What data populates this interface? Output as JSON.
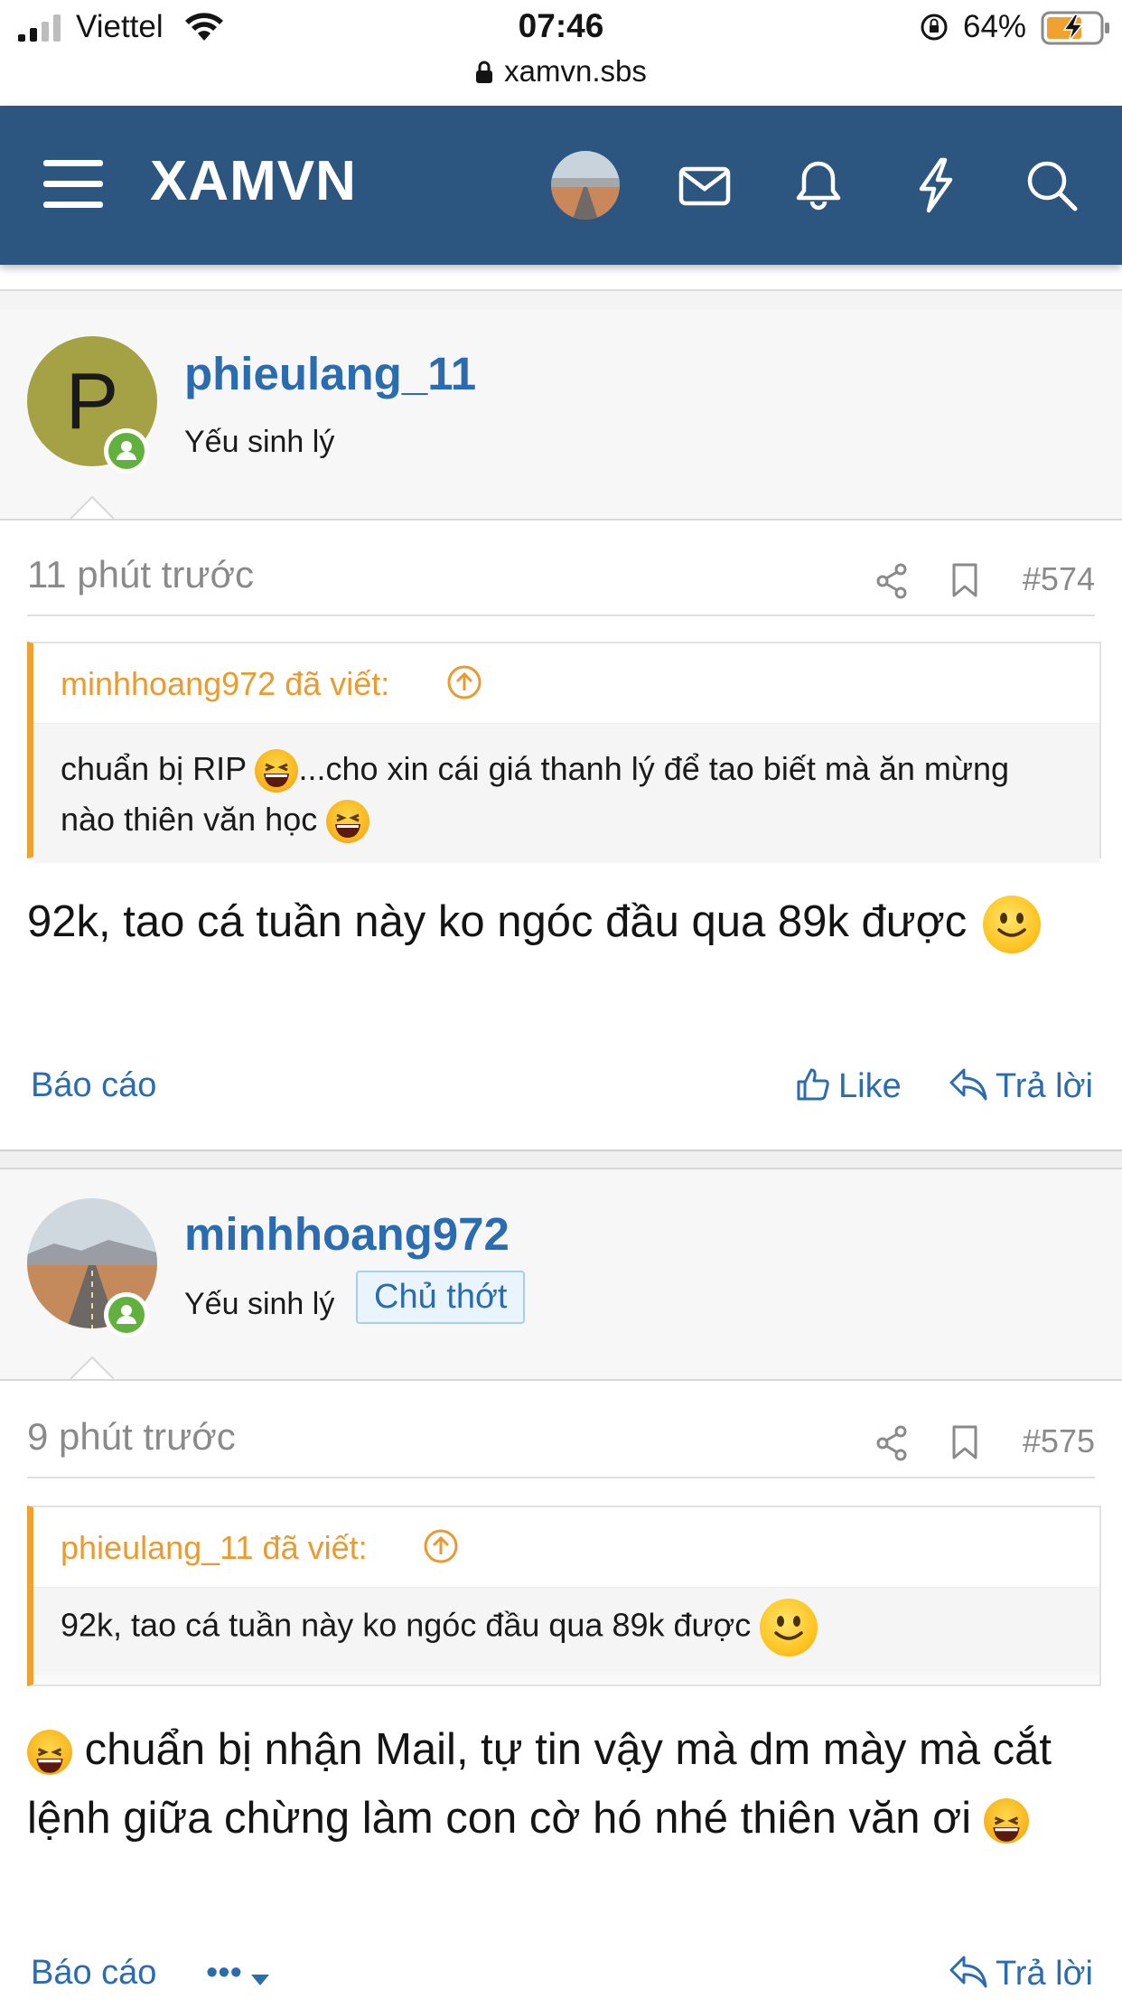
{
  "status_bar": {
    "carrier": "Viettel",
    "time": "07:46",
    "battery": "64%",
    "url": "xamvn.sbs"
  },
  "header": {
    "logo": "XAMVN",
    "icons": [
      "menu-icon",
      "avatar",
      "mail-icon",
      "bell-icon",
      "flash-icon",
      "search-icon"
    ],
    "color": "#2c5680"
  },
  "posts": [
    {
      "username": "phieulang_11",
      "avatar_letter": "P",
      "user_title": "Yếu sinh lý",
      "time": "11 phút trước",
      "number": "#574",
      "quote": {
        "author_line": "minhhoang972 đã viết:",
        "text_1": "chuẩn bị RIP ",
        "text_2": "...cho xin cái giá thanh lý để tao biết mà ăn mừng nào thiên văn học "
      },
      "text": "92k, tao cá tuần này ko ngóc đầu qua 89k được",
      "actions": {
        "report": "Báo cáo",
        "like": "Like",
        "reply": "Trả lời"
      }
    },
    {
      "username": "minhhoang972",
      "user_title": "Yếu sinh lý",
      "badge": "Chủ thớt",
      "time": "9 phút trước",
      "number": "#575",
      "quote": {
        "author_line": "phieulang_11 đã viết:",
        "text": "92k, tao cá tuần này ko ngóc đầu qua 89k được "
      },
      "text": " chuẩn bị nhận Mail, tự tin vậy mà dm mày mà cắt lệnh giữa chừng làm con cờ hó nhé thiên văn ơi ",
      "actions": {
        "report": "Báo cáo",
        "more": "•••",
        "reply": "Trả lời"
      }
    }
  ],
  "colors": {
    "link": "#2b6bb0",
    "quote_accent": "#f0a231",
    "online": "#62b13f"
  }
}
